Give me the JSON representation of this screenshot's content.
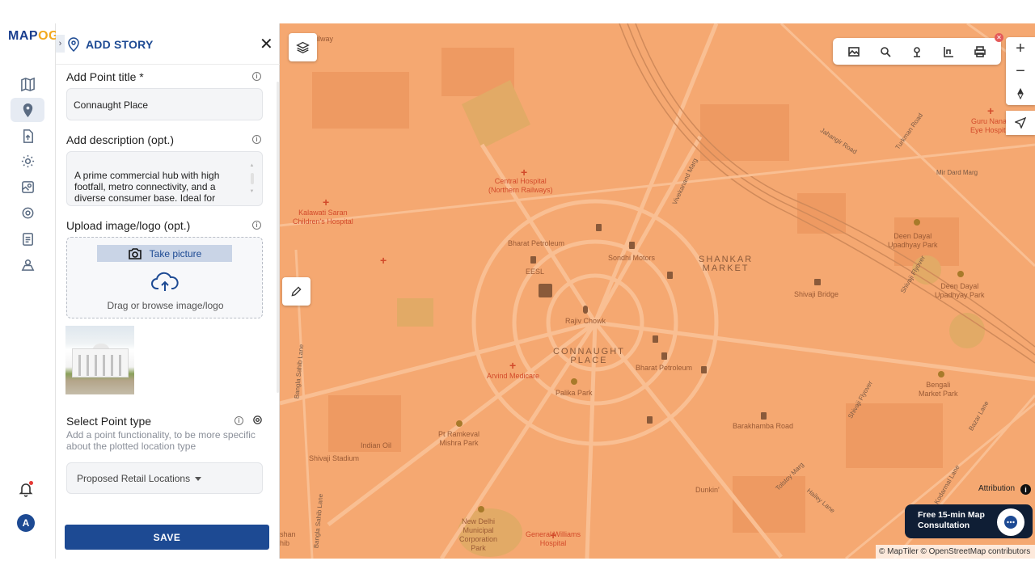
{
  "app": {
    "logo_text_main": "MAP",
    "logo_text_accent": "OG"
  },
  "rail": {
    "avatar_letter": "A",
    "items": [
      "map-icon",
      "location-pin-icon",
      "file-upload-icon",
      "settings-icon",
      "map-pins-icon",
      "gear-icon",
      "clipboard-icon",
      "user-location-icon"
    ]
  },
  "panel": {
    "title": "ADD STORY",
    "point_title_label": "Add Point title *",
    "point_title_value": "Connaught Place",
    "description_label": "Add description (opt.)",
    "description_value": "A prime commercial hub with high footfall, metro connectivity, and a diverse consumer base. Ideal for",
    "upload_label": "Upload image/logo (opt.)",
    "take_picture": "Take picture",
    "drag_text": "Drag or browse image/logo",
    "point_type_label": "Select Point type",
    "point_type_hint": "Add a point functionality, to be more specific about the plotted location type",
    "point_type_value": "Proposed Retail Locations",
    "save_label": "SAVE"
  },
  "map": {
    "colors": {
      "base": "#f5a871",
      "road": "#f9bf93",
      "block": "#ee9a62",
      "park": "#e0a45a",
      "accent": "#1d4a93"
    },
    "attribution": "Attribution",
    "copyright": "© MapTiler © OpenStreetMap contributors",
    "cta_line1": "Free 15-min Map",
    "cta_line2": "Consultation",
    "labels": {
      "l1": "Central Hospital\n(Northern Railways)",
      "l2": "Kalawati Saran\nChildren's Hospital",
      "l3": "Bharat Petroleum",
      "l4": "Sondhi Motors",
      "l5": "EESL",
      "l6": "Rajiv Chowk",
      "l7": "CONNAUGHT\nPLACE",
      "l8": "SHANKAR\nMARKET",
      "l9": "Bharat Petroleum",
      "l10": "Arvind Medicare",
      "l11": "Palika Park",
      "l12": "Shivaji Bridge",
      "l13": "Deen Dayal\nUpadhyay Park",
      "l14": "Deen Dayal\nUpadhyay Park",
      "l15": "Mir Dard Marg",
      "l16": "Guru Nanak\nEye Hospital",
      "l17": "Jahangir Road",
      "l18": "Turkman Road",
      "l19": "Vivekanand Marg",
      "l20": "Barakhamba Road",
      "l21": "Bengali\nMarket Park",
      "l22": "Pt Ramkeval\nMishra Park",
      "l23": "Indian Oil",
      "l24": "Shivaji Stadium",
      "l25": "Dunkin'",
      "l26": "New Delhi\nMunicipal\nCorporation\nPark",
      "l27": "General Williams\nHospital",
      "l28": "Bangla Sahib Lane",
      "l29": "Tolstoy Marg",
      "l30": "Hailey Lane",
      "l31": "Shivaji Flyover",
      "l32": "Bazar Lane",
      "l33": "Bangla Sahib Lane",
      "l34": "Kodarmal Lane",
      "l35": "Shivaji Flyover",
      "l36": "ilway",
      "l37": "shan\nhib"
    }
  }
}
